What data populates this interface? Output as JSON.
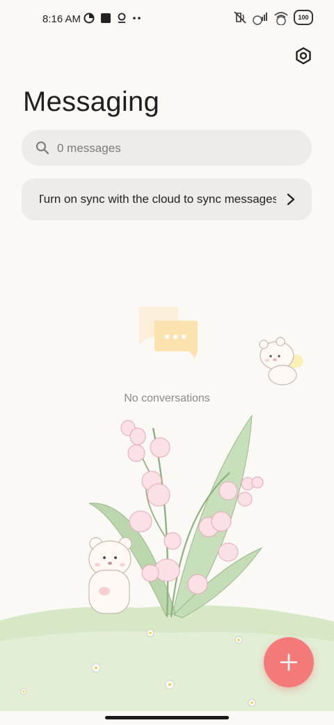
{
  "status_bar": {
    "time": "8:16 AM",
    "battery": "100",
    "left_icons": [
      "data-saver-icon",
      "square-notification-icon",
      "location-icon",
      "more-dots-icon"
    ],
    "right_icons": [
      "mute-vibrate-icon",
      "signal-icon",
      "wifi-icon",
      "battery-icon"
    ]
  },
  "header": {
    "title": "Messaging",
    "settings_icon": "settings-icon"
  },
  "search": {
    "placeholder": "0 messages"
  },
  "sync_banner": {
    "text": "Turn on sync with the cloud to sync messages"
  },
  "empty_state": {
    "text": "No conversations"
  },
  "fab": {
    "icon": "plus-icon",
    "color": "#f47a7a"
  },
  "colors": {
    "background": "#fbf9f6",
    "surface": "#eeecea",
    "accent": "#f47a7a"
  }
}
